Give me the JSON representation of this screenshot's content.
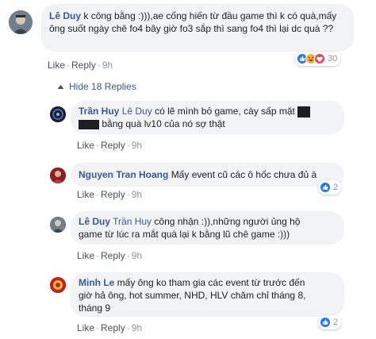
{
  "comment": {
    "author": "Lê Duy",
    "text": "k công bằng :))),ae cống hiến từ đầu game thì k có quà,mấy ông suốt ngày chê fo4 bây giờ fo3 sắp thì sang fo4 thì lại dc quà ??",
    "like_label": "Like",
    "reply_label": "Reply",
    "time": "9h",
    "reaction_count": "30",
    "reaction_icons": [
      "like-icon",
      "haha-icon",
      "love-icon"
    ]
  },
  "replies_toggle": {
    "label": "Hide 18 Replies"
  },
  "replies": [
    {
      "author": "Trần Huy",
      "mention": "Lê Duy",
      "text_a": "có lẽ mình bỏ game, cày sấp mặt",
      "text_b": "bằng quà lv10 của nó sợ thật",
      "like_label": "Like",
      "reply_label": "Reply",
      "time": "9h"
    },
    {
      "author": "Nguyen Tran Hoang",
      "text": "Mấy event cũ các ô hốc chưa đủ à",
      "like_label": "Like",
      "reply_label": "Reply",
      "time": "9h",
      "reaction_count": "2"
    },
    {
      "author": "Lê Duy",
      "mention": "Trần Huy",
      "text_a": "công nhận :)),những người ủng hộ",
      "text_b": "game từ lúc ra mắt quà lại k bằng lũ chê game :)))",
      "like_label": "Like",
      "reply_label": "Reply",
      "time": "9h"
    },
    {
      "author": "Minh Le",
      "text_a": "mấy ông ko tham gia các event từ trước đến",
      "text_b": "giờ hả ông, hot summer, NHD, HLV chăm chỉ tháng 8,",
      "text_c": "tháng 9",
      "like_label": "Like",
      "reply_label": "Reply",
      "time": "9h",
      "reaction_count": "2"
    }
  ],
  "colors": {
    "link_blue": "#385898",
    "bubble_bg": "#f2f3f5",
    "meta_gray": "#90949c",
    "like_blue": "#2078f4"
  }
}
